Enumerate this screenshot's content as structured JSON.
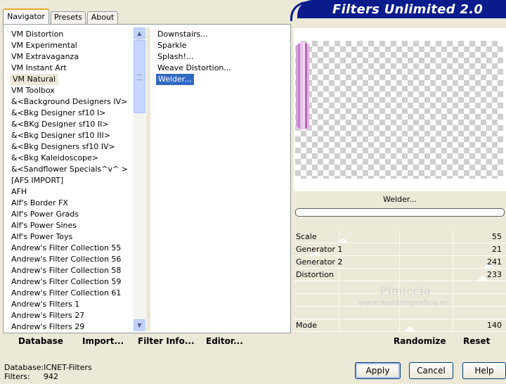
{
  "tabs": [
    "Navigator",
    "Presets",
    "About"
  ],
  "banner_title": "Filters Unlimited 2.0",
  "categories": [
    "VM Distortion",
    "VM Experimental",
    "VM Extravaganza",
    "VM Instant Art",
    "VM Natural",
    "VM Toolbox",
    "&<Background Designers IV>",
    "&<Bkg Designer sf10 I>",
    "&<BKg Designer sf10 II>",
    "&<Bkg Designer sf10 III>",
    "&<Bkg Designers sf10 IV>",
    "&<Bkg Kaleidoscope>",
    "&<Sandflower Specials^v^ >",
    "[AFS IMPORT]",
    "AFH",
    "Alf's Border FX",
    "Alf's Power Grads",
    "Alf's Power Sines",
    "Alf's Power Toys",
    "Andrew's Filter Collection 55",
    "Andrew's Filter Collection 56",
    "Andrew's Filter Collection 58",
    "Andrew's Filter Collection 59",
    "Andrew's Filter Collection 61",
    "Andrew's Filters 1",
    "Andrew's Filters 27",
    "Andrew's Filters 29"
  ],
  "selected_category_index": 4,
  "filters": [
    "Downstairs...",
    "Sparkle",
    "Splash!...",
    "Weave Distortion...",
    "Welder..."
  ],
  "selected_filter_index": 4,
  "bottom_buttons": {
    "database": "Database",
    "import": "Import...",
    "filter_info": "Filter Info...",
    "editor": "Editor..."
  },
  "current_filter": "Welder...",
  "params": [
    {
      "label": "Scale",
      "value": "55",
      "level": 0.216
    },
    {
      "label": "Generator 1",
      "value": "21",
      "level": 0.082
    },
    {
      "label": "Generator 2",
      "value": "241",
      "level": 0.945
    },
    {
      "label": "Distortion",
      "value": "233",
      "level": 0.914
    }
  ],
  "mode": {
    "label": "Mode",
    "value": "140",
    "level": 0.549
  },
  "watermark": {
    "line1": "Pinuccia",
    "line2": "www.maidiregrafica.eu"
  },
  "randomize_label": "Randomize",
  "reset_label": "Reset",
  "status": {
    "database_label": "Database:",
    "database_value": "ICNET-Filters",
    "filters_label": "Filters:",
    "filters_value": "942"
  },
  "dialog_buttons": {
    "apply": "Apply",
    "cancel": "Cancel",
    "help": "Help"
  },
  "colors": {
    "banner": "#0a1b8c",
    "selection": "#316ac5",
    "dialog_bg": "#ece9d8"
  }
}
